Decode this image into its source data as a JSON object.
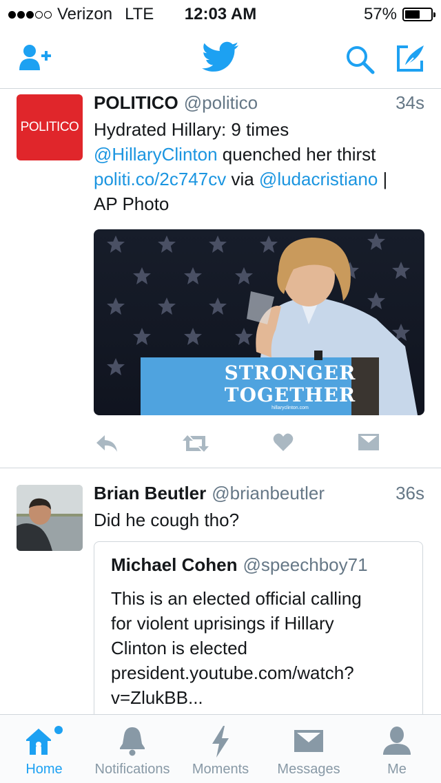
{
  "status_bar": {
    "carrier": "Verizon",
    "network": "LTE",
    "time": "12:03 AM",
    "battery": "57%",
    "battery_level": 0.57,
    "signal_bars": 3
  },
  "nav": {
    "add_user_icon": "add-user-icon",
    "logo_icon": "twitter-bird-icon",
    "search_icon": "search-icon",
    "compose_icon": "compose-icon"
  },
  "tweets": [
    {
      "name": "POLITICO",
      "handle": "@politico",
      "time": "34s",
      "avatar_text": "POLITICO",
      "text_parts": {
        "p1": "Hydrated Hillary: 9 times",
        "mention1": "@HillaryClinton",
        "p2": " quenched her thirst",
        "link": "politi.co/2c747cv",
        "p3": " via ",
        "mention2": "@ludacristiano",
        "p4": " |",
        "p5": "AP Photo"
      },
      "image": {
        "sign_line1": "STRONGER",
        "sign_line2": "TOGETHER",
        "sign_url": "hillaryclinton.com"
      }
    },
    {
      "name": "Brian Beutler",
      "handle": "@brianbeutler",
      "time": "36s",
      "text": "Did he cough tho?",
      "quote": {
        "name": "Michael Cohen",
        "handle": "@speechboy71",
        "lines": [
          "This is an elected official calling",
          "for violent uprisings if Hillary",
          "Clinton is elected",
          "president.youtube.com/watch?",
          "v=ZlukBB..."
        ]
      }
    }
  ],
  "tab_bar": {
    "tabs": [
      {
        "label": "Home",
        "icon": "home-icon",
        "active": true
      },
      {
        "label": "Notifications",
        "icon": "bell-icon"
      },
      {
        "label": "Moments",
        "icon": "lightning-icon"
      },
      {
        "label": "Messages",
        "icon": "envelope-icon"
      },
      {
        "label": "Me",
        "icon": "person-icon"
      }
    ]
  },
  "colors": {
    "accent": "#1da1f2",
    "link": "#1b95e0",
    "politico_red": "#e0262b",
    "sign_blue": "#4fa3df"
  }
}
